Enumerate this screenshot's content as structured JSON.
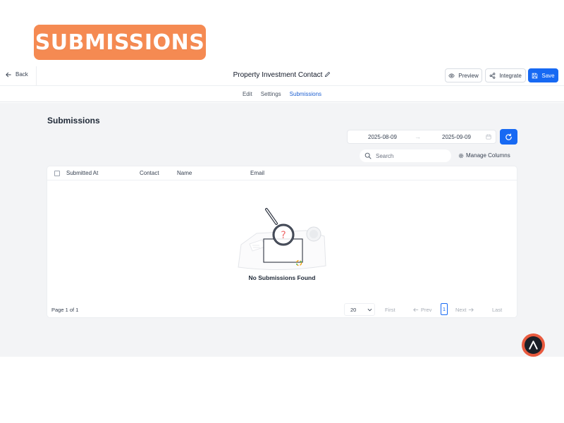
{
  "banner": {
    "text": "SUBMISSIONS"
  },
  "header": {
    "back_label": "Back",
    "form_title": "Property Investment Contact",
    "preview_label": "Preview",
    "integrate_label": "Integrate",
    "save_label": "Save"
  },
  "tabs": [
    {
      "label": "Edit",
      "active": false
    },
    {
      "label": "Settings",
      "active": false
    },
    {
      "label": "Submissions",
      "active": true
    }
  ],
  "page": {
    "heading": "Submissions"
  },
  "filters": {
    "start_date": "2025-08-09",
    "end_date": "2025-09-09",
    "arrow": "→",
    "search_placeholder": "Search",
    "manage_columns_label": "Manage Columns"
  },
  "table": {
    "columns": [
      "Submitted At",
      "Contact",
      "Name",
      "Email"
    ],
    "rows": [],
    "empty_message": "No Submissions Found"
  },
  "pagination": {
    "page_info": "Page 1 of 1",
    "page_size": "20",
    "first_label": "First",
    "prev_label": "Prev",
    "current_page": "1",
    "next_label": "Next",
    "last_label": "Last"
  },
  "icons": {
    "back": "arrow-left-icon",
    "edit_title": "pencil-icon",
    "preview": "eye-icon",
    "integrate": "share-icon",
    "save": "floppy-disk-icon",
    "calendar": "calendar-icon",
    "refresh": "refresh-icon",
    "search": "search-icon",
    "manage_columns": "gear-icon",
    "brand": "brand-logo-icon"
  },
  "colors": {
    "accent": "#1769f3",
    "banner": "#f58a52",
    "brand_ring": "#e85a3f",
    "page_bg": "#f3f4f6"
  }
}
